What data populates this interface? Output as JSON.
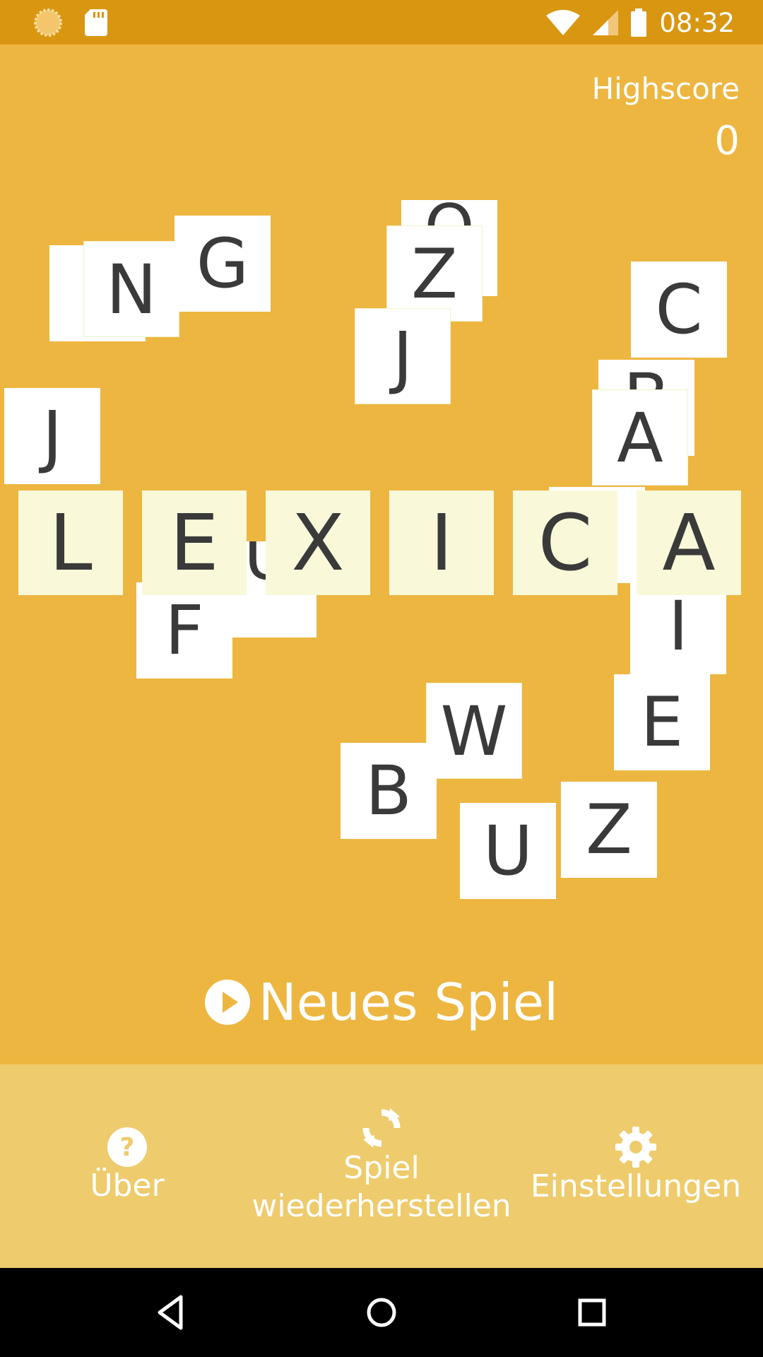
{
  "status_bar": {
    "time": "08:32"
  },
  "highscore": {
    "label": "Highscore",
    "value": "0"
  },
  "title_tiles": [
    "L",
    "E",
    "X",
    "I",
    "C",
    "A"
  ],
  "tiles": [
    "N",
    "G",
    "Z",
    "J",
    "C",
    "J",
    "A",
    "F",
    "I",
    "E",
    "W",
    "B",
    "U",
    "Z"
  ],
  "partial_tiles": [
    "O",
    "B",
    "U"
  ],
  "new_game_label": "Neues Spiel",
  "bottom_nav": {
    "about_label": "Über",
    "restore_label_1": "Spiel",
    "restore_label_2": "wiederherstellen",
    "settings_label": "Einstellungen"
  },
  "colors": {
    "status_bar": "#D99611",
    "background": "#EDB640",
    "bottom_bar": "#EECB6C",
    "tile": "#FFFFFF",
    "title_tile": "#F9F8D9"
  }
}
